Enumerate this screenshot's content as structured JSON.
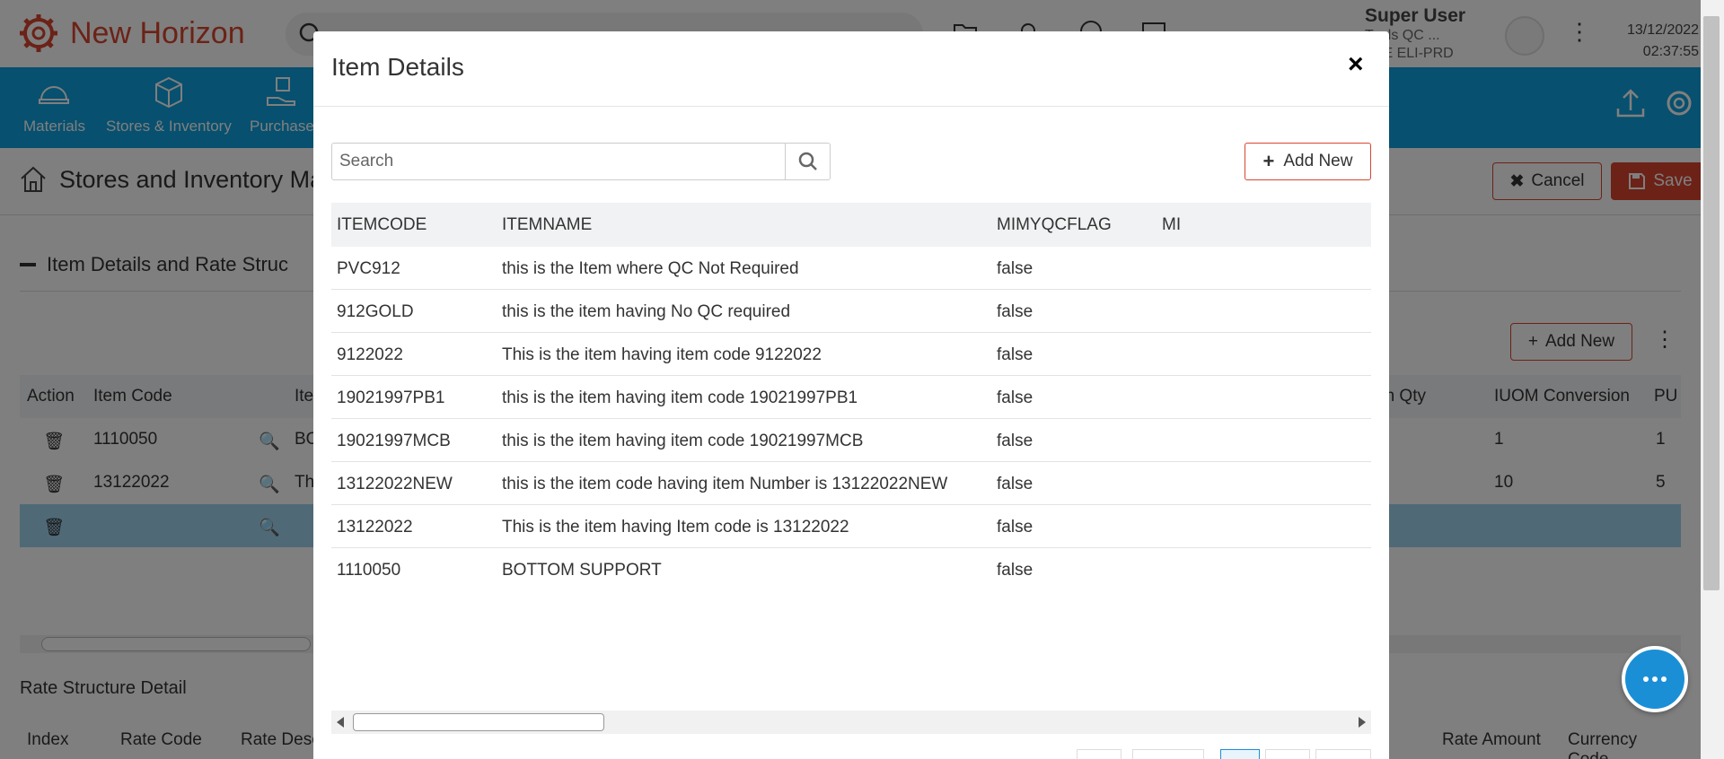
{
  "app": {
    "brand": "New Horizon",
    "user": {
      "name": "Super User",
      "line1": "Tools QC ...",
      "line2": "RLE ELI-PRD"
    },
    "datetime": {
      "date": "13/12/2022",
      "time": "02:37:55"
    }
  },
  "nav": {
    "items": [
      {
        "label": "Materials",
        "icon": "helmet-icon"
      },
      {
        "label": "Stores & Inventory",
        "icon": "boxes-icon"
      },
      {
        "label": "Purchase",
        "icon": "hand-box-icon"
      }
    ]
  },
  "page": {
    "title": "Stores and Inventory Ma",
    "cancel_label": "Cancel",
    "save_label": "Save",
    "section_title": "Item Details and Rate Struc",
    "add_new_label": "Add New",
    "table": {
      "headers": {
        "action": "Action",
        "item_code": "Item Code",
        "item": "Ite",
        "plan_qty": "an Qty",
        "iuom": "IUOM Conversion",
        "puc": "PU"
      },
      "rows": [
        {
          "code": "1110050",
          "item": "BO",
          "iuom": "1",
          "puc": "1"
        },
        {
          "code": "13122022",
          "item": "Th",
          "iuom": "10",
          "puc": "5"
        },
        {
          "code": "",
          "item": "",
          "iuom": "",
          "puc": ""
        }
      ]
    },
    "rate_section": {
      "title": "Rate Structure Detail",
      "headers": {
        "index": "Index",
        "rate_code": "Rate Code",
        "rate_desc": "Rate Desc",
        "rate_amount": "Rate Amount",
        "currency": "Currency Code"
      }
    }
  },
  "modal": {
    "title": "Item Details",
    "close_glyph": "×",
    "search_placeholder": "Search",
    "search_value": "",
    "add_new_label": "Add New",
    "columns": [
      "ITEMCODE",
      "ITEMNAME",
      "MIMYQCFLAG",
      "MI"
    ],
    "rows": [
      {
        "code": "PVC912",
        "name": "this is the Item where QC Not Required",
        "qc": "false"
      },
      {
        "code": "912GOLD",
        "name": "this is the item having No QC required",
        "qc": "false"
      },
      {
        "code": "9122022",
        "name": "This is the item having item code 9122022",
        "qc": "false"
      },
      {
        "code": "19021997PB1",
        "name": "this is the item having item code 19021997PB1",
        "qc": "false"
      },
      {
        "code": "19021997MCB",
        "name": "this is the item having item code 19021997MCB",
        "qc": "false"
      },
      {
        "code": "13122022NEW",
        "name": "this is the item code having item Number is 13122022NEW",
        "qc": "false"
      },
      {
        "code": "13122022",
        "name": "This is the item having Item code is 13122022",
        "qc": "false"
      },
      {
        "code": "1110050",
        "name": "BOTTOM SUPPORT",
        "qc": "false"
      }
    ]
  },
  "colors": {
    "brand": "#d8452f",
    "nav": "#0ea0de",
    "selected_row": "#9fd3ef",
    "chat": "#1a8fd6"
  }
}
